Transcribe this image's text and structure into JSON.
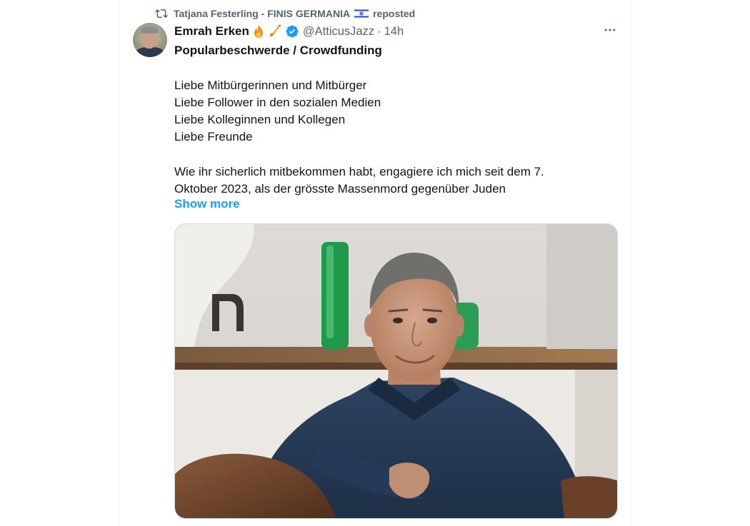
{
  "repost": {
    "reposter_name": "Tatjana Festerling - FINIS GERMANIA",
    "reposted_label": "reposted",
    "icon": "repost-icon",
    "flag_icon": "israel-flag-icon"
  },
  "tweet": {
    "author": {
      "display_name": "Emrah Erken",
      "emojis": [
        "fire-emoji",
        "saxophone-emoji"
      ],
      "verified": true,
      "handle": "@AtticusJazz",
      "separator": "·",
      "time": "14h"
    },
    "more_icon": "more-horizontal-icon",
    "title": "Popularbeschwerde / Crowdfunding",
    "greeting_lines": [
      "Liebe Mitbürgerinnen und Mitbürger",
      "Liebe Follower in den sozialen Medien",
      "Liebe Kolleginnen und Kollegen",
      "Liebe Freunde"
    ],
    "paragraph_lines": [
      "Wie ihr sicherlich mitbekommen habt, engagiere ich mich seit dem 7.",
      "Oktober 2023, als der grösste Massenmord gegenüber Juden"
    ],
    "show_more_label": "Show more",
    "media": {
      "type": "photo"
    }
  },
  "colors": {
    "text_primary": "#0f1419",
    "text_secondary": "#536471",
    "accent": "#1d9bf0",
    "border": "#eff3f4"
  }
}
